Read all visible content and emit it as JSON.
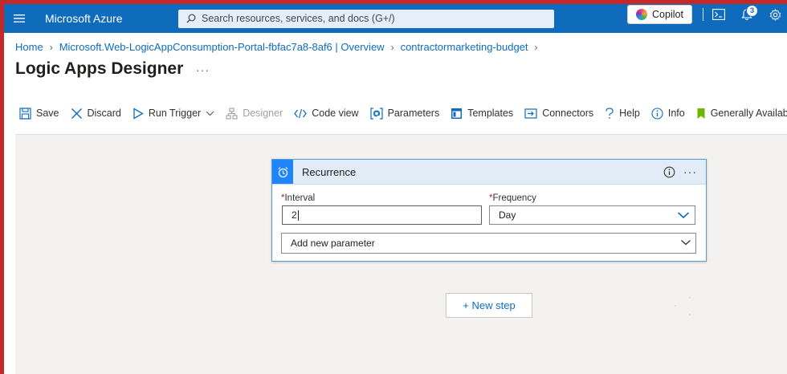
{
  "topbar": {
    "brand": "Microsoft Azure",
    "search_placeholder": "Search resources, services, and docs (G+/)",
    "copilot_label": "Copilot",
    "notification_count": "3",
    "accent_color": "#0f6cbd"
  },
  "breadcrumb": {
    "items": [
      "Home",
      "Microsoft.Web-LogicAppConsumption-Portal-fbfac7a8-8af6 | Overview",
      "contractormarketing-budget"
    ]
  },
  "page": {
    "title": "Logic Apps Designer",
    "more_label": "···"
  },
  "toolbar": {
    "save": "Save",
    "discard": "Discard",
    "run_trigger": "Run Trigger",
    "designer": "Designer",
    "code_view": "Code view",
    "parameters": "Parameters",
    "templates": "Templates",
    "connectors": "Connectors",
    "help": "Help",
    "info": "Info",
    "generally_available": "Generally Available D"
  },
  "recurrence": {
    "title": "Recurrence",
    "more_label": "···",
    "interval_label": "Interval",
    "interval_value": "2",
    "frequency_label": "Frequency",
    "frequency_value": "Day",
    "add_parameter": "Add new parameter",
    "required_mark": "*"
  },
  "canvas": {
    "new_step": "+ New step"
  }
}
